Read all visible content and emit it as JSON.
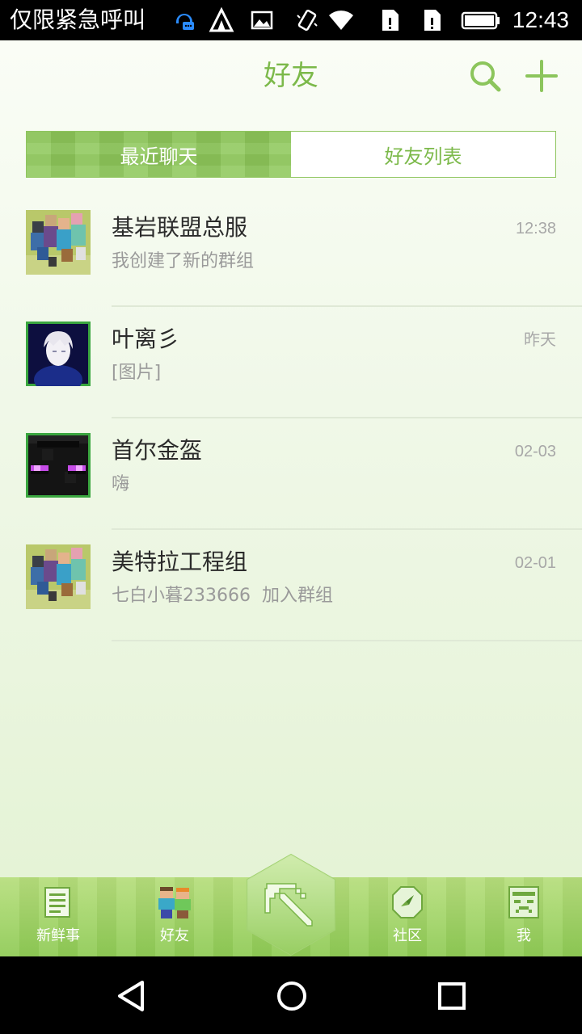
{
  "status_bar": {
    "carrier": "仅限紧急呼叫",
    "time": "12:43"
  },
  "header": {
    "title": "好友",
    "search_icon": "search-icon",
    "add_icon": "plus-icon"
  },
  "segments": {
    "recent": "最近聊天",
    "friends": "好友列表",
    "active": "recent"
  },
  "chats": [
    {
      "name": "基岩联盟总服",
      "preview": "我创建了新的群组",
      "time": "12:38",
      "avatar": "group-avatar"
    },
    {
      "name": "叶离彡",
      "preview": "[图片]",
      "time": "昨天",
      "avatar": "portrait-avatar"
    },
    {
      "name": "首尔金盔",
      "preview": "嗨",
      "time": "02-03",
      "avatar": "enderman-avatar"
    },
    {
      "name": "美特拉工程组",
      "preview": "七白小暮233666  加入群组",
      "time": "02-01",
      "avatar": "group-avatar"
    }
  ],
  "tabs": {
    "news": "新鲜事",
    "friends": "好友",
    "community": "社区",
    "me": "我"
  },
  "colors": {
    "accent": "#7cb94a",
    "tab_bar": "#8fcb55"
  }
}
